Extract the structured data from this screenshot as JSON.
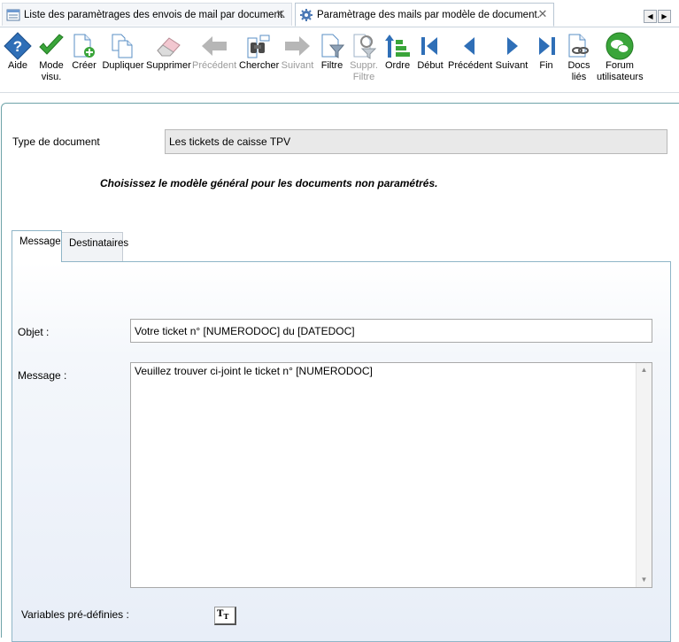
{
  "tabs": [
    {
      "label": "Liste des paramètrages des envois de mail par document.",
      "close": "✕"
    },
    {
      "label": "Paramètrage des mails par modèle de document.",
      "close": "✕"
    }
  ],
  "tab_nav": {
    "left": "◀",
    "right": "▶"
  },
  "toolbar": {
    "aide": {
      "l1": "Aide",
      "l2": "",
      "icon": "help-diamond-icon"
    },
    "mode": {
      "l1": "Mode",
      "l2": "visu.",
      "icon": "check-icon"
    },
    "creer": {
      "l1": "Créer",
      "l2": "",
      "icon": "new-document-icon"
    },
    "dupliquer": {
      "l1": "Dupliquer",
      "l2": "",
      "icon": "duplicate-icon"
    },
    "supprimer": {
      "l1": "Supprimer",
      "l2": "",
      "icon": "eraser-icon"
    },
    "precedent": {
      "l1": "Précédent",
      "l2": "",
      "icon": "arrow-left-icon"
    },
    "chercher": {
      "l1": "Chercher",
      "l2": "",
      "icon": "binoculars-icon"
    },
    "suivant": {
      "l1": "Suivant",
      "l2": "",
      "icon": "arrow-right-icon"
    },
    "filtre": {
      "l1": "Filtre",
      "l2": "",
      "icon": "filter-icon"
    },
    "suppr_filtre": {
      "l1": "Suppr.",
      "l2": "Filtre",
      "icon": "remove-filter-icon"
    },
    "ordre": {
      "l1": "Ordre",
      "l2": "",
      "icon": "sort-order-icon"
    },
    "debut": {
      "l1": "Début",
      "l2": "",
      "icon": "first-record-icon"
    },
    "precedent2": {
      "l1": "Précédent",
      "l2": "",
      "icon": "previous-record-icon"
    },
    "suivant2": {
      "l1": "Suivant",
      "l2": "",
      "icon": "next-record-icon"
    },
    "fin": {
      "l1": "Fin",
      "l2": "",
      "icon": "last-record-icon"
    },
    "docs": {
      "l1": "Docs",
      "l2": "liés",
      "icon": "linked-docs-icon"
    },
    "forum": {
      "l1": "Forum",
      "l2": "utilisateurs",
      "icon": "forum-chat-icon"
    }
  },
  "form": {
    "doc_type_label": "Type de document",
    "doc_type_value": "Les tickets de caisse TPV",
    "hint": "Choisissez le modèle général pour les documents non paramétrés.",
    "inner_tabs": [
      {
        "label": "Message"
      },
      {
        "label": "Destinataires"
      }
    ],
    "objet_label": "Objet :",
    "objet_value": "Votre ticket n° [NUMERODOC] du [DATEDOC]",
    "message_label": "Message :",
    "message_value": "Veuillez trouver ci-joint le ticket n° [NUMERODOC]",
    "variables_label": "Variables pré-définies :",
    "variables_button": "T"
  },
  "colors": {
    "accent": "#2a73b8",
    "green": "#3aa53a",
    "disabled": "#9a9a9a",
    "panel_border": "#8fb5c7"
  }
}
